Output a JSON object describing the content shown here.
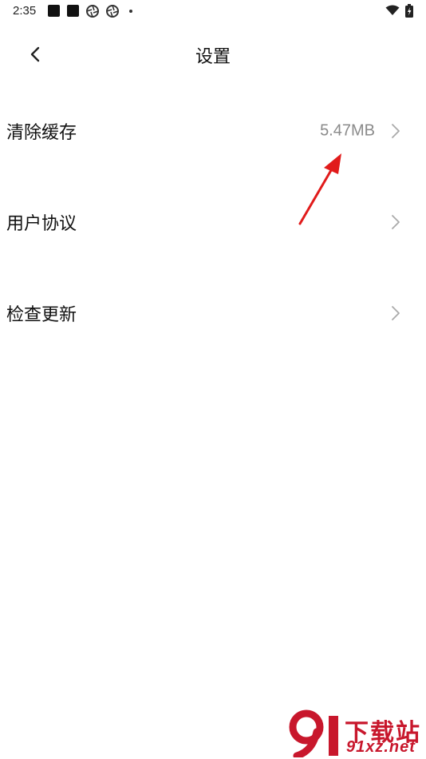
{
  "status_bar": {
    "time": "2:35",
    "icons": [
      "notification-square-icon",
      "notification-square-icon",
      "aperture-icon",
      "aperture-icon",
      "dot-icon",
      "wifi-icon",
      "battery-charging-icon"
    ]
  },
  "header": {
    "title": "设置",
    "back_icon": "chevron-left-icon"
  },
  "settings": {
    "items": [
      {
        "label": "清除缓存",
        "value": "5.47MB",
        "icon": "chevron-right-icon"
      },
      {
        "label": "用户协议",
        "value": "",
        "icon": "chevron-right-icon"
      },
      {
        "label": "检查更新",
        "value": "",
        "icon": "chevron-right-icon"
      }
    ]
  },
  "annotation": {
    "arrow_color": "#e11b1b"
  },
  "watermark": {
    "logo_text": "91",
    "title": "下载站",
    "domain": "91xz.net",
    "color": "#c8172c"
  }
}
